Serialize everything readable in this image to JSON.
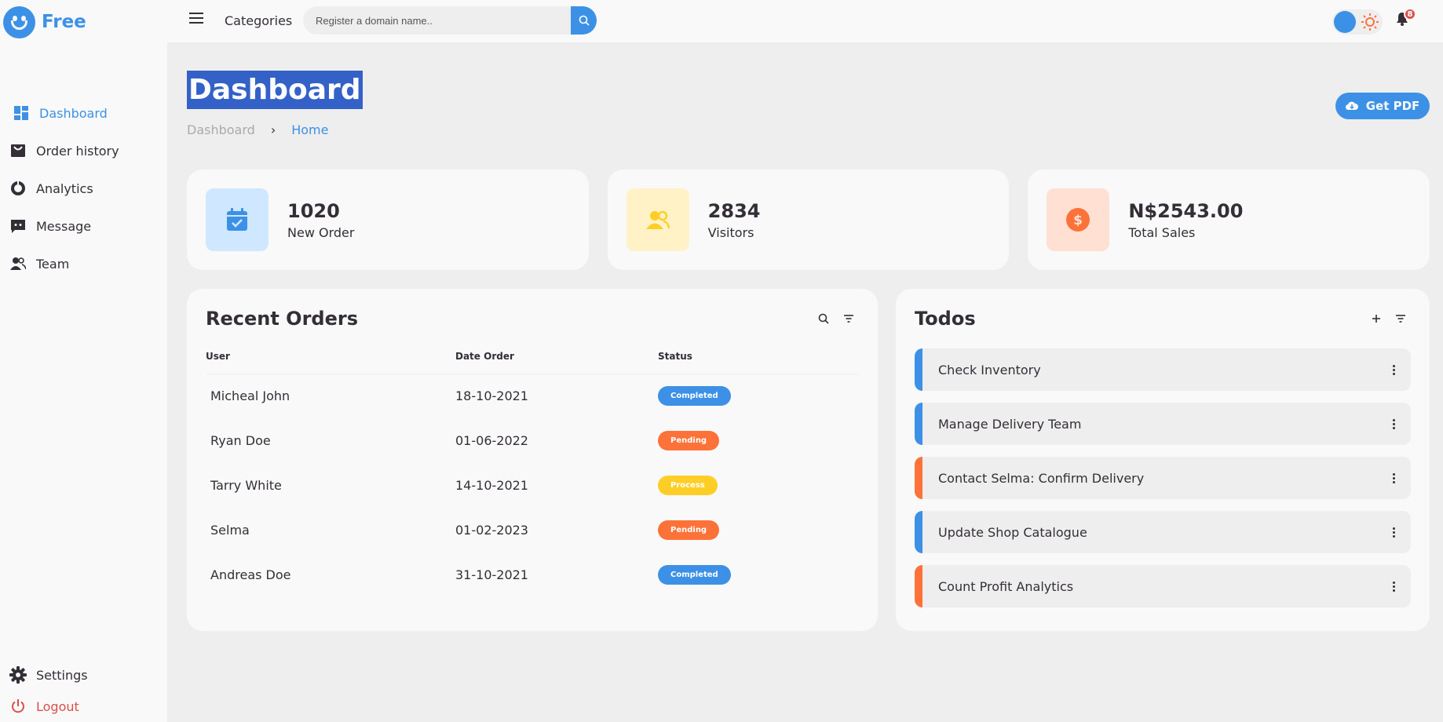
{
  "brand": {
    "name": "Free"
  },
  "sidebar": {
    "items": [
      {
        "label": "Dashboard",
        "icon": "dashboard-icon"
      },
      {
        "label": "Order history",
        "icon": "shopping-bag-icon"
      },
      {
        "label": "Analytics",
        "icon": "doughnut-chart-icon"
      },
      {
        "label": "Message",
        "icon": "message-icon"
      },
      {
        "label": "Team",
        "icon": "group-icon"
      }
    ],
    "bottom": [
      {
        "label": "Settings",
        "icon": "gear-icon"
      },
      {
        "label": "Logout",
        "icon": "power-icon"
      }
    ]
  },
  "topnav": {
    "categories": "Categories",
    "search": {
      "placeholder": "Register a domain name..",
      "value": ""
    },
    "notifications": "8"
  },
  "main": {
    "title": "Dashboard",
    "breadcrumb": [
      "Dashboard",
      "›",
      "Home"
    ],
    "download_label": "Get PDF"
  },
  "stats": [
    {
      "value": "1020",
      "label": "New Order",
      "icon": "calendar-check-icon"
    },
    {
      "value": "2834",
      "label": "Visitors",
      "icon": "group-icon"
    },
    {
      "value": "N$2543.00",
      "label": "Total Sales",
      "icon": "dollar-circle-icon"
    }
  ],
  "orders": {
    "title": "Recent Orders",
    "columns": [
      "User",
      "Date Order",
      "Status"
    ],
    "rows": [
      {
        "user": "Micheal John",
        "date": "18-10-2021",
        "status": "Completed",
        "type": "completed"
      },
      {
        "user": "Ryan Doe",
        "date": "01-06-2022",
        "status": "Pending",
        "type": "pending"
      },
      {
        "user": "Tarry White",
        "date": "14-10-2021",
        "status": "Process",
        "type": "process"
      },
      {
        "user": "Selma",
        "date": "01-02-2023",
        "status": "Pending",
        "type": "pending"
      },
      {
        "user": "Andreas Doe",
        "date": "31-10-2021",
        "status": "Completed",
        "type": "completed"
      }
    ]
  },
  "todos": {
    "title": "Todos",
    "items": [
      {
        "label": "Check Inventory",
        "color": "#3c91e6"
      },
      {
        "label": "Manage Delivery Team",
        "color": "#3c91e6"
      },
      {
        "label": "Contact Selma: Confirm Delivery",
        "color": "#fd7238"
      },
      {
        "label": "Update Shop Catalogue",
        "color": "#3c91e6"
      },
      {
        "label": "Count Profit Analytics",
        "color": "#fd7238"
      }
    ]
  },
  "colors": {
    "accent": "#3c91e6",
    "orange": "#fd7238",
    "yellow": "#ffce26",
    "red": "#db504a",
    "title_highlight": "#3461c8"
  }
}
